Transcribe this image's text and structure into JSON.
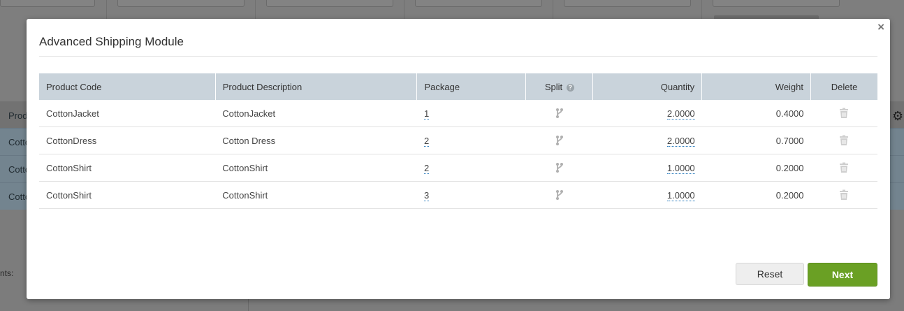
{
  "background": {
    "rows": [
      {
        "text": "Cotto"
      },
      {
        "text": "Cotto"
      },
      {
        "text": "Cotto"
      }
    ],
    "header_text": "Prod",
    "footer_label": "nts:"
  },
  "modal": {
    "title": "Advanced Shipping Module",
    "close_glyph": "×",
    "columns": {
      "code": "Product Code",
      "description": "Product Description",
      "package": "Package",
      "split": "Split",
      "quantity": "Quantity",
      "weight": "Weight",
      "delete": "Delete"
    },
    "rows": [
      {
        "code": "CottonJacket",
        "description": "CottonJacket",
        "package": "1",
        "quantity": "2.0000",
        "weight": "0.4000"
      },
      {
        "code": "CottonDress",
        "description": "Cotton Dress",
        "package": "2",
        "quantity": "2.0000",
        "weight": "0.7000"
      },
      {
        "code": "CottonShirt",
        "description": "CottonShirt",
        "package": "2",
        "quantity": "1.0000",
        "weight": "0.2000"
      },
      {
        "code": "CottonShirt",
        "description": "CottonShirt",
        "package": "3",
        "quantity": "1.0000",
        "weight": "0.2000"
      }
    ],
    "buttons": {
      "reset": "Reset",
      "next": "Next"
    }
  },
  "icons": {
    "split": "split-icon",
    "delete": "trash-icon",
    "help": "question-circle-icon",
    "settings": "gear-icon"
  },
  "colors": {
    "header_bg": "#c9d3db",
    "primary_button": "#6aa024",
    "reset_button": "#eeeeee"
  }
}
